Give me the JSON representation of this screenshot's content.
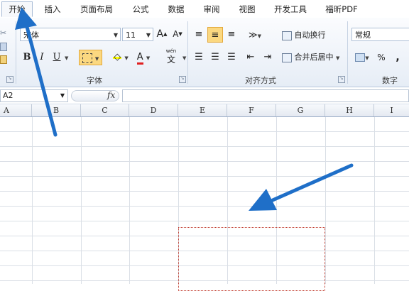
{
  "ribbon_tabs": [
    "开始",
    "插入",
    "页面布局",
    "公式",
    "数据",
    "审阅",
    "视图",
    "开发工具",
    "福昕PDF"
  ],
  "font_group": {
    "font_name": "宋体",
    "font_size": "11",
    "grow": "A",
    "shrink": "A",
    "bold": "B",
    "italic": "I",
    "underline": "U",
    "font_color_letter": "A",
    "phonetic": "wén",
    "phonetic_char": "文",
    "label": "字体"
  },
  "alignment_group": {
    "wrap_text": "自动换行",
    "merge_center": "合并后居中",
    "label": "对齐方式"
  },
  "number_group": {
    "format": "常规",
    "percent": "%",
    "comma": ",",
    "label": "数字"
  },
  "name_box": "A2",
  "fx": "fx",
  "columns": [
    "A",
    "B",
    "C",
    "D",
    "E",
    "F",
    "G",
    "H",
    "I"
  ],
  "colors": {
    "arrow": "#1f6fc8",
    "selection_marquee": "#c0392b",
    "ribbon_bg": "#e6edf6"
  }
}
